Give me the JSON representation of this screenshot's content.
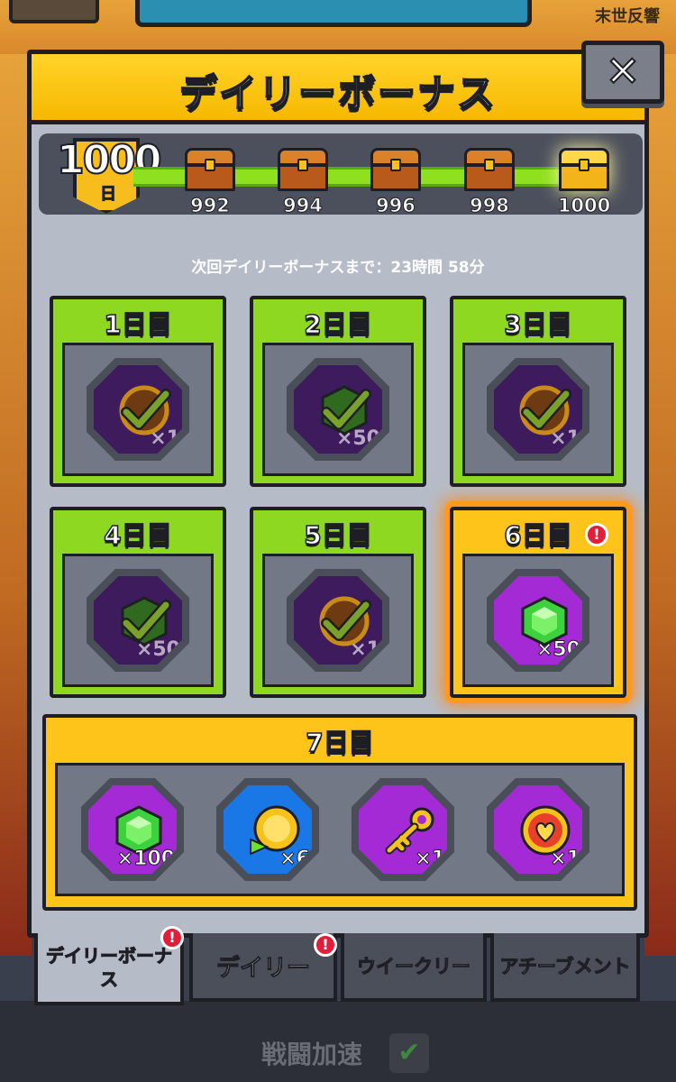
{
  "background": {
    "top_right_label": "末世反響",
    "speed_label": "戦闘加速"
  },
  "modal": {
    "title": "デイリーボーナス",
    "close_label": "✕",
    "login_days": "1000",
    "login_days_unit": "日",
    "milestones": [
      "992",
      "994",
      "996",
      "998",
      "1000"
    ],
    "timer_text": "次回デイリーボーナスまで：23時間 58分"
  },
  "days": [
    {
      "label": "1日目",
      "reward": "gold-medal-icon",
      "qty": "×1",
      "claimed": true
    },
    {
      "label": "2日目",
      "reward": "green-gem-icon",
      "qty": "×50",
      "claimed": true
    },
    {
      "label": "3日目",
      "reward": "gold-medal-icon",
      "qty": "×1",
      "claimed": true
    },
    {
      "label": "4日目",
      "reward": "green-gem-icon",
      "qty": "×50",
      "claimed": true
    },
    {
      "label": "5日目",
      "reward": "gold-medal-icon",
      "qty": "×1",
      "claimed": true
    },
    {
      "label": "6日目",
      "reward": "green-gem-icon",
      "qty": "×50",
      "claimed": false
    }
  ],
  "day7": {
    "label": "7日目",
    "rewards": [
      {
        "reward": "green-gem-icon",
        "qty": "×100"
      },
      {
        "reward": "speed-coin-icon",
        "qty": "×6"
      },
      {
        "reward": "gold-key-icon",
        "qty": "×1"
      },
      {
        "reward": "heart-coin-icon",
        "qty": "×1"
      }
    ]
  },
  "tabs": [
    {
      "label": "デイリーボーナス",
      "active": true,
      "alert": true
    },
    {
      "label": "デイリー",
      "active": false,
      "alert": true
    },
    {
      "label": "ウイークリー",
      "active": false,
      "alert": false
    },
    {
      "label": "アチーブメント",
      "active": false,
      "alert": false
    }
  ],
  "colors": {
    "title_yellow": "#ffd42a",
    "claimed_green": "#8fd822",
    "active_gold": "#ffc41a",
    "panel_gray": "#b6bcc7",
    "alert_red": "#e0203a"
  }
}
